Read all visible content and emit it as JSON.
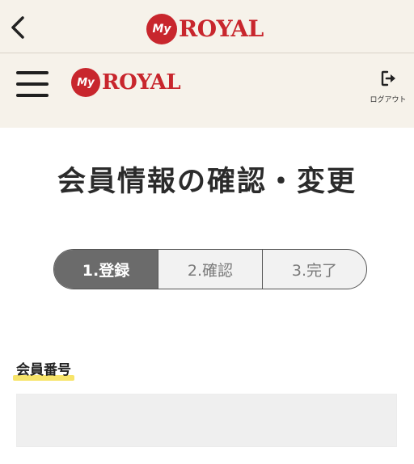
{
  "topbar": {
    "back_icon": "chevron-left-icon",
    "logo": {
      "badge": "My",
      "word": "ROYAL"
    }
  },
  "header": {
    "menu_icon": "hamburger-icon",
    "logo": {
      "badge": "My",
      "word": "ROYAL"
    },
    "logout": {
      "icon": "logout-icon",
      "label": "ログアウト"
    }
  },
  "main": {
    "title": "会員情報の確認・変更",
    "steps": [
      {
        "label": "1.登録",
        "active": true
      },
      {
        "label": "2.確認",
        "active": false
      },
      {
        "label": "3.完了",
        "active": false
      }
    ],
    "member_number": {
      "label": "会員番号",
      "value": ""
    }
  },
  "colors": {
    "brand_red": "#c8262d",
    "header_bg": "#f6f2ea",
    "active_step": "#6b6b6b",
    "highlight": "#f7e46a"
  }
}
